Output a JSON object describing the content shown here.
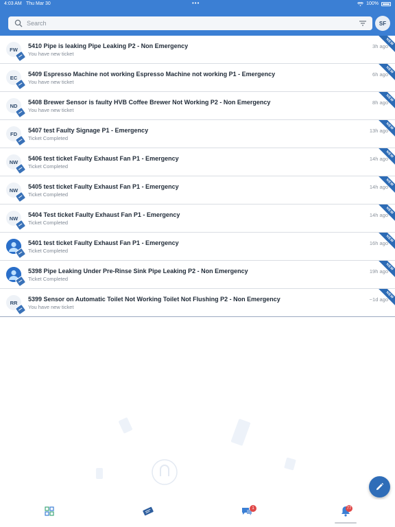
{
  "status_bar": {
    "time": "4:03 AM",
    "date": "Thu Mar 30",
    "battery": "100%"
  },
  "search": {
    "placeholder": "Search"
  },
  "user": {
    "initials": "SF"
  },
  "tickets": [
    {
      "avatar": "FW",
      "title": "5410 Pipe is leaking Pipe Leaking P2 - Non Emergency",
      "subtitle": "You have new ticket",
      "time": "3h ago",
      "badge": "NEW"
    },
    {
      "avatar": "EC",
      "title": "5409 Espresso Machine not working Espresso Machine not working P1 - Emergency",
      "subtitle": "You have new ticket",
      "time": "6h ago",
      "badge": "NEW"
    },
    {
      "avatar": "ND",
      "title": "5408 Brewer Sensor is faulty HVB Coffee Brewer Not Working P2 - Non Emergency",
      "subtitle": "You have new ticket",
      "time": "8h ago",
      "badge": "NEW"
    },
    {
      "avatar": "FD",
      "title": "5407 test Faulty Signage P1 - Emergency",
      "subtitle": "Ticket Completed",
      "time": "13h ago",
      "badge": "NEW"
    },
    {
      "avatar": "NW",
      "title": "5406 test ticket Faulty Exhaust Fan P1 - Emergency",
      "subtitle": "Ticket Completed",
      "time": "14h ago",
      "badge": "NEW"
    },
    {
      "avatar": "NW",
      "title": "5405 test ticket Faulty Exhaust Fan P1 - Emergency",
      "subtitle": "Ticket Completed",
      "time": "14h ago",
      "badge": "NEW"
    },
    {
      "avatar": "NW",
      "title": "5404 Test ticket Faulty Exhaust Fan P1 - Emergency",
      "subtitle": "Ticket Completed",
      "time": "14h ago",
      "badge": "NEW"
    },
    {
      "avatar": "",
      "title": "5401 test ticket Faulty Exhaust Fan P1 - Emergency",
      "subtitle": "Ticket Completed",
      "time": "16h ago",
      "badge": "NEW"
    },
    {
      "avatar": "",
      "title": "5398 Pipe Leaking Under Pre-Rinse Sink Pipe Leaking P2 - Non Emergency",
      "subtitle": "Ticket Completed",
      "time": "19h ago",
      "badge": "NEW"
    },
    {
      "avatar": "RR",
      "title": "5399 Sensor on Automatic Toilet Not Working Toilet Not Flushing P2 - Non Emergency",
      "subtitle": "You have new ticket",
      "time": "~1d ago",
      "badge": "NEW"
    }
  ],
  "bottom_nav": {
    "messages_badge": "1",
    "notifications_badge": "77"
  },
  "colors": {
    "header": "#3b7fd4",
    "accent": "#2f6db8",
    "badge": "#e04848"
  }
}
